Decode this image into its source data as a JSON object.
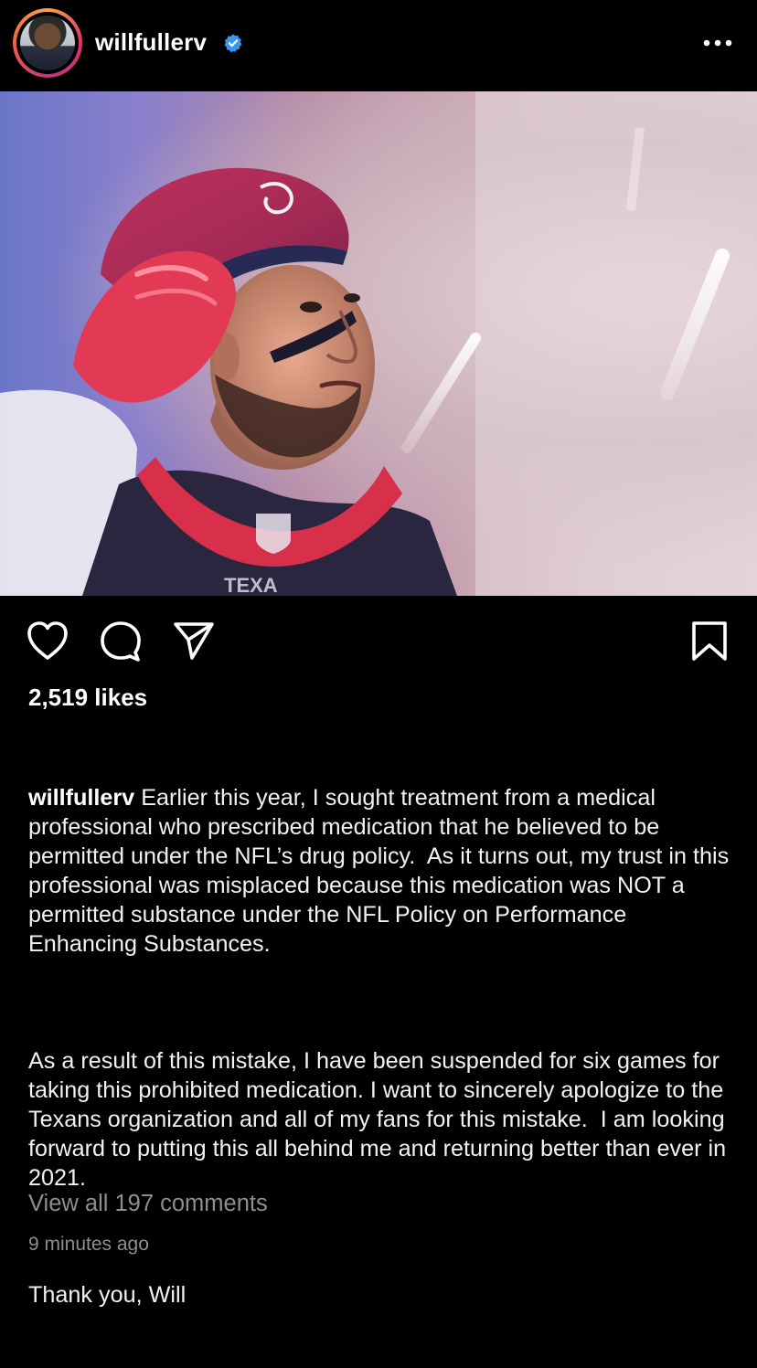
{
  "post": {
    "username": "willfullerv",
    "verified": true,
    "likes": "2,519 likes",
    "caption_user": "willfullerv",
    "caption_p1": "Earlier this year, I sought treatment from a medical professional who prescribed medication that he believed to be permitted under the NFL’s drug policy.  As it turns out, my trust in this professional was misplaced because this medication was NOT a permitted substance under the NFL Policy on Performance Enhancing Substances.",
    "caption_p2": "As a result of this mistake, I have been suspended for six games for taking this prohibited medication. I want to sincerely apologize to the Texans organization and all of my fans for this mistake.  I am looking forward to putting this all behind me and returning better than ever in 2021.",
    "caption_p3": "Thank you, Will",
    "view_comments": "View all 197 comments",
    "timestamp": "9 minutes ago"
  },
  "photo": {
    "jersey_text": "TEXA",
    "description_icon": "player-photo"
  },
  "icons": {
    "like": "heart-icon",
    "comment": "comment-icon",
    "share": "share-icon",
    "save": "bookmark-icon",
    "more": "more-options-icon",
    "verified": "verified-badge-icon"
  },
  "colors": {
    "background": "#000000",
    "text": "#f5f5f5",
    "muted": "#8e8e8e",
    "verified_blue": "#3897f0"
  }
}
